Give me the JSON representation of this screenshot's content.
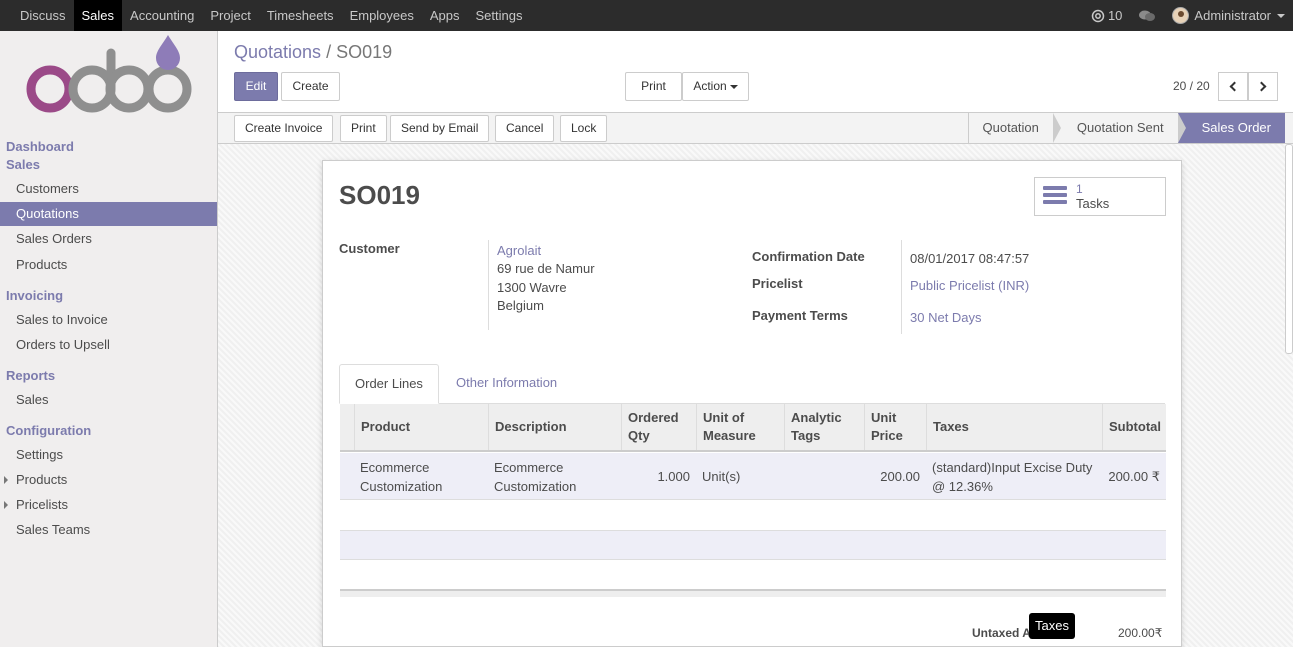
{
  "topbar": {
    "menu": [
      "Discuss",
      "Sales",
      "Accounting",
      "Project",
      "Timesheets",
      "Employees",
      "Apps",
      "Settings"
    ],
    "active_index": 1,
    "notifications_count": "10",
    "user": "Administrator"
  },
  "sidebar": {
    "dashboard": "Dashboard",
    "sections": [
      {
        "title": "Sales",
        "items": [
          "Customers",
          "Quotations",
          "Sales Orders",
          "Products"
        ]
      },
      {
        "title": "Invoicing",
        "items": [
          "Sales to Invoice",
          "Orders to Upsell"
        ]
      },
      {
        "title": "Reports",
        "items": [
          "Sales"
        ]
      },
      {
        "title": "Configuration",
        "items": [
          "Settings",
          "Products",
          "Pricelists",
          "Sales Teams"
        ]
      }
    ],
    "active_item": "Quotations"
  },
  "breadcrumb": {
    "parent": "Quotations",
    "sep": "/",
    "current": "SO019"
  },
  "buttons": {
    "edit": "Edit",
    "create": "Create",
    "print": "Print",
    "action": "Action"
  },
  "pager": {
    "text": "20 / 20"
  },
  "statusbar": {
    "buttons": [
      "Create Invoice",
      "Print",
      "Send by Email",
      "Cancel",
      "Lock"
    ],
    "stages": [
      "Quotation",
      "Quotation Sent",
      "Sales Order"
    ],
    "active_stage": "Sales Order"
  },
  "form": {
    "title": "SO019",
    "tasks": {
      "count": "1",
      "label": "Tasks"
    },
    "customer_label": "Customer",
    "customer": {
      "name": "Agrolait",
      "line1": "69 rue de Namur",
      "line2": "1300 Wavre",
      "line3": "Belgium"
    },
    "confirmation_date_label": "Confirmation Date",
    "confirmation_date": "08/01/2017 08:47:57",
    "pricelist_label": "Pricelist",
    "pricelist": "Public Pricelist (INR)",
    "payment_terms_label": "Payment Terms",
    "payment_terms": "30 Net Days"
  },
  "tabs": {
    "order_lines": "Order Lines",
    "other_info": "Other Information"
  },
  "table": {
    "headers": {
      "product": "Product",
      "description": "Description",
      "ordered_qty_1": "Ordered",
      "ordered_qty_2": "Qty",
      "uom_1": "Unit of",
      "uom_2": "Measure",
      "tags_1": "Analytic",
      "tags_2": "Tags",
      "price_1": "Unit",
      "price_2": "Price",
      "taxes": "Taxes",
      "subtotal": "Subtotal"
    },
    "rows": [
      {
        "product_1": "Ecommerce",
        "product_2": "Customization",
        "description_1": "Ecommerce",
        "description_2": "Customization",
        "qty": "1.000",
        "uom": "Unit(s)",
        "tags": "",
        "price": "200.00",
        "taxes_1": "(standard)Input Excise Duty",
        "taxes_2": "@ 12.36%",
        "subtotal": "200.00 ₹"
      }
    ]
  },
  "totals": {
    "untaxed_label": "Untaxed Amount :",
    "untaxed_value": "200.00₹"
  },
  "tooltip": "Taxes",
  "colors": {
    "accent": "#7c7bad",
    "topbar": "#2c2c2c"
  }
}
